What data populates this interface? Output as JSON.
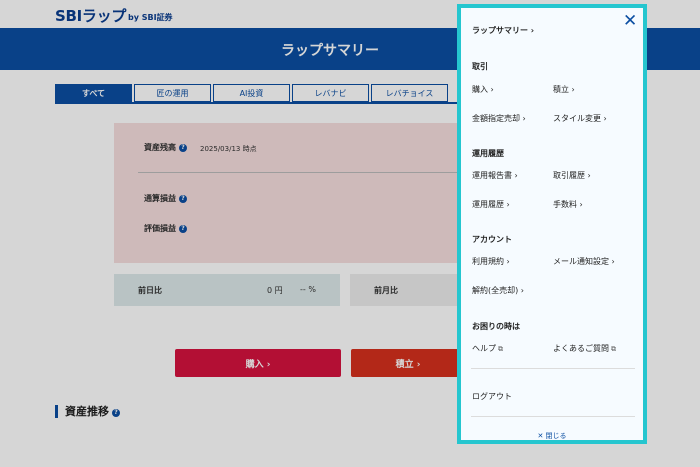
{
  "header": {
    "logo": "SBIラップ",
    "logo_by": "by SBI証券",
    "page_title": "ラップサマリー"
  },
  "tabs": [
    {
      "label": "すべて"
    },
    {
      "label": "匠の運用"
    },
    {
      "label": "AI投資"
    },
    {
      "label": "レバナビ"
    },
    {
      "label": "レバチョイス"
    }
  ],
  "summary": {
    "balance_label": "資産残高",
    "date": "2025/03/13 時点",
    "total_pnl_label": "通算損益",
    "eval_pnl_label": "評価損益",
    "day_compare_label": "前日比",
    "day_compare_value": "0 円",
    "day_compare_pct": "-- %",
    "month_compare_label": "前月比"
  },
  "actions": {
    "buy": "購入 ›",
    "tsumitate": "積立 ›"
  },
  "section": {
    "asset_trend": "資産推移"
  },
  "menu": {
    "summary_link": "ラップサマリー ›",
    "trade_head": "取引",
    "trade_items": [
      "購入 ›",
      "積立 ›",
      "金額指定売却 ›",
      "スタイル変更 ›"
    ],
    "history_head": "運用履歴",
    "history_items": [
      "運用報告書 ›",
      "取引履歴 ›",
      "運用履歴 ›",
      "手数料 ›"
    ],
    "account_head": "アカウント",
    "account_items": [
      "利用規約 ›",
      "メール通知設定 ›",
      "解約(全売却) ›"
    ],
    "help_head": "お困りの時は",
    "help_items": [
      "ヘルプ",
      "よくあるご質問"
    ],
    "logout": "ログアウト",
    "close_label": "閉じる"
  }
}
